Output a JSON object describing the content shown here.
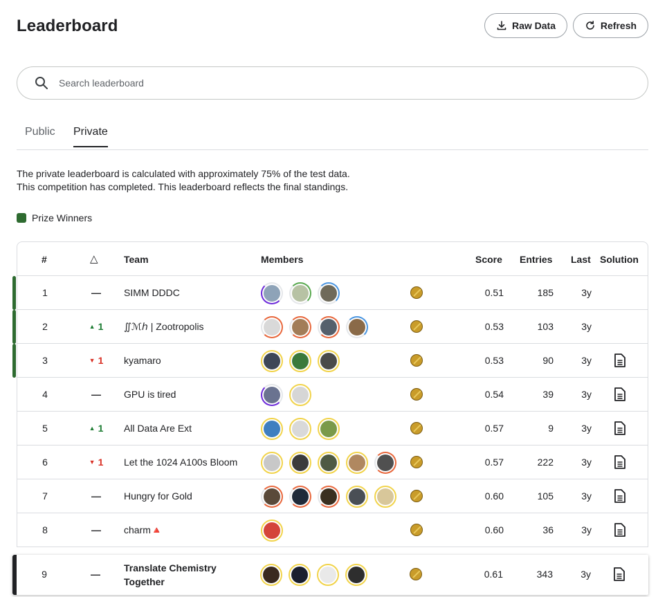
{
  "header": {
    "title": "Leaderboard",
    "raw_data_label": "Raw Data",
    "refresh_label": "Refresh"
  },
  "search": {
    "placeholder": "Search leaderboard"
  },
  "tabs": [
    {
      "label": "Public",
      "active": false
    },
    {
      "label": "Private",
      "active": true
    }
  ],
  "description": {
    "line1": "The private leaderboard is calculated with approximately 75% of the test data.",
    "line2": "This competition has completed. This leaderboard reflects the final standings."
  },
  "legend": {
    "label": "Prize Winners",
    "color": "#2e6b30"
  },
  "columns": {
    "rank": "#",
    "delta": "△",
    "team": "Team",
    "members": "Members",
    "score": "Score",
    "entries": "Entries",
    "last": "Last",
    "solution": "Solution"
  },
  "colors": {
    "up": "#1e7d34",
    "down": "#d93025",
    "prize": "#2e6b30",
    "medal": "#c99c2a"
  },
  "rows": [
    {
      "rank": "1",
      "delta": "—",
      "team": "SIMM DDDC",
      "score": "0.51",
      "entries": "185",
      "last": "3y"
    },
    {
      "rank": "2",
      "delta": "1",
      "delta_dir": "up",
      "team": "∬ℳℎ | Zootropolis",
      "score": "0.53",
      "entries": "103",
      "last": "3y"
    },
    {
      "rank": "3",
      "delta": "1",
      "delta_dir": "down",
      "team": "kyamaro",
      "score": "0.53",
      "entries": "90",
      "last": "3y"
    },
    {
      "rank": "4",
      "delta": "—",
      "team": "GPU is tired",
      "score": "0.54",
      "entries": "39",
      "last": "3y"
    },
    {
      "rank": "5",
      "delta": "1",
      "delta_dir": "up",
      "team": "All Data Are Ext",
      "score": "0.57",
      "entries": "9",
      "last": "3y"
    },
    {
      "rank": "6",
      "delta": "1",
      "delta_dir": "down",
      "team": "Let the 1024 A100s Bloom",
      "score": "0.57",
      "entries": "222",
      "last": "3y"
    },
    {
      "rank": "7",
      "delta": "—",
      "team": "Hungry for Gold",
      "score": "0.60",
      "entries": "105",
      "last": "3y"
    },
    {
      "rank": "8",
      "delta": "—",
      "team": "charm🔺",
      "score": "0.60",
      "entries": "36",
      "last": "3y"
    }
  ],
  "self_row": {
    "rank": "9",
    "delta": "—",
    "team": "Translate Chemistry Together",
    "score": "0.61",
    "entries": "343",
    "last": "3y"
  }
}
